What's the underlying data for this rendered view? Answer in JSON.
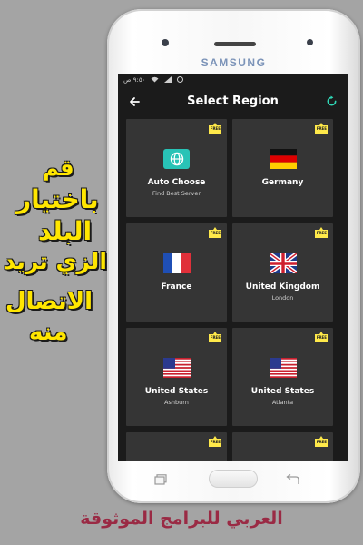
{
  "promo": {
    "lines": [
      "قم",
      "باختيار",
      "البلد",
      "الزي تريد",
      "الاتصال",
      "منه"
    ]
  },
  "footer": {
    "text": "العربي للبرامج الموثوقة"
  },
  "phone": {
    "brand": "SAMSUNG"
  },
  "status_bar": {
    "time": "٩:٥٠ ص"
  },
  "app_bar": {
    "title": "Select Region",
    "back_icon": "arrow-left-icon",
    "refresh_icon": "refresh-icon"
  },
  "colors": {
    "screen_bg": "#1b1b1b",
    "card_bg": "#353535",
    "badge": "#ffe94a",
    "auto_icon_bg": "#28c3b6",
    "refresh_icon": "#2fd6b5",
    "promo_text": "#ffe600",
    "footer_text": "#9a2a44"
  },
  "regions": [
    {
      "name": "Auto Choose",
      "sub": "Find Best Server",
      "badge": "FREE",
      "icon": "globe-icon"
    },
    {
      "name": "Germany",
      "sub": "",
      "badge": "FREE",
      "icon": "germany-flag-icon"
    },
    {
      "name": "France",
      "sub": "",
      "badge": "FREE",
      "icon": "france-flag-icon"
    },
    {
      "name": "United Kingdom",
      "sub": "London",
      "badge": "FREE",
      "icon": "uk-flag-icon"
    },
    {
      "name": "United States",
      "sub": "Ashburn",
      "badge": "FREE",
      "icon": "us-flag-icon"
    },
    {
      "name": "United States",
      "sub": "Atlanta",
      "badge": "FREE",
      "icon": "us-flag-icon"
    },
    {
      "name": "",
      "sub": "",
      "badge": "FREE",
      "icon": ""
    },
    {
      "name": "",
      "sub": "",
      "badge": "FREE",
      "icon": ""
    }
  ]
}
